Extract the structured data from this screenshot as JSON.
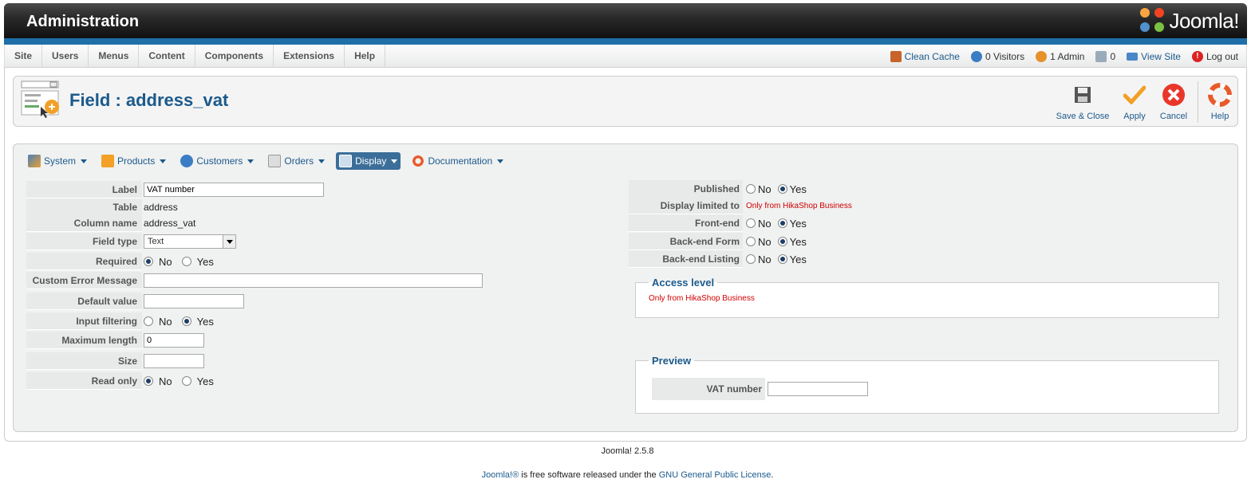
{
  "header": {
    "title": "Administration",
    "logo_text": "Joomla!"
  },
  "menu": {
    "items": [
      "Site",
      "Users",
      "Menus",
      "Content",
      "Components",
      "Extensions",
      "Help"
    ]
  },
  "status": {
    "clean_cache": "Clean Cache",
    "visitors": "0 Visitors",
    "admin": "1 Admin",
    "messages": "0",
    "view_site": "View Site",
    "logout": "Log out"
  },
  "toolbar": {
    "page_title": "Field : address_vat",
    "buttons": {
      "save_close": "Save & Close",
      "apply": "Apply",
      "cancel": "Cancel",
      "help": "Help"
    }
  },
  "hika_menu": [
    "System",
    "Products",
    "Customers",
    "Orders",
    "Display",
    "Documentation"
  ],
  "hika_menu_active": "Display",
  "form_left": {
    "label": {
      "label": "Label",
      "value": "VAT number"
    },
    "table": {
      "label": "Table",
      "value": "address"
    },
    "column_name": {
      "label": "Column name",
      "value": "address_vat"
    },
    "field_type": {
      "label": "Field type",
      "value": "Text"
    },
    "required": {
      "label": "Required",
      "selected": "No"
    },
    "custom_error": {
      "label": "Custom Error Message",
      "value": ""
    },
    "default_value": {
      "label": "Default value",
      "value": ""
    },
    "input_filtering": {
      "label": "Input filtering",
      "selected": "Yes"
    },
    "max_length": {
      "label": "Maximum length",
      "value": "0"
    },
    "size": {
      "label": "Size",
      "value": ""
    },
    "read_only": {
      "label": "Read only",
      "selected": "No"
    }
  },
  "radio_labels": {
    "no": "No",
    "yes": "Yes"
  },
  "form_right": {
    "published": {
      "label": "Published",
      "selected": "Yes"
    },
    "display_limited": {
      "label": "Display limited to",
      "value": "Only from HikaShop Business"
    },
    "front_end": {
      "label": "Front-end",
      "selected": "Yes"
    },
    "backend_form": {
      "label": "Back-end Form",
      "selected": "Yes"
    },
    "backend_listing": {
      "label": "Back-end Listing",
      "selected": "Yes"
    }
  },
  "access_level": {
    "legend": "Access level",
    "text": "Only from HikaShop Business"
  },
  "preview": {
    "legend": "Preview",
    "label": "VAT number",
    "value": ""
  },
  "footer": {
    "version": "Joomla! 2.5.8",
    "joomla_link": "Joomla!®",
    "license_mid": " is free software released under the ",
    "license_link": "GNU General Public License",
    "license_end": "."
  }
}
